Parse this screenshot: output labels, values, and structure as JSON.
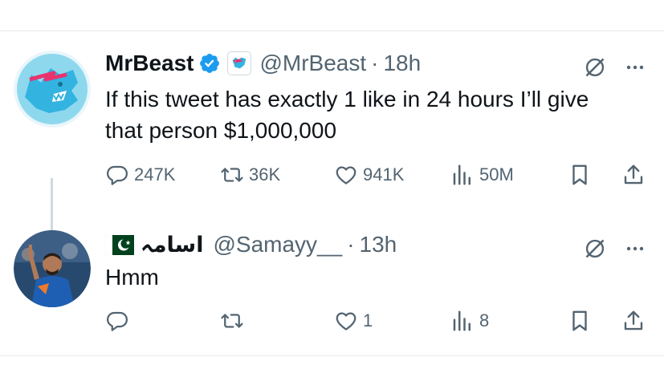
{
  "tweets": [
    {
      "name": "MrBeast",
      "handle": "@MrBeast",
      "time": "18h",
      "separator": "·",
      "text": "If this tweet has exactly 1 like in 24 hours I’ll give that person $1,000,000",
      "stats": {
        "replies": "247K",
        "retweets": "36K",
        "likes": "941K",
        "views": "50M"
      },
      "verified": true,
      "accent_color": "#1d9bf0"
    },
    {
      "name": "اسامہ",
      "handle": "@Samayy__",
      "time": "13h",
      "separator": "·",
      "text": "Hmm",
      "stats": {
        "replies": "",
        "retweets": "",
        "likes": "1",
        "views": "8"
      },
      "flag_icon": "pakistan-flag-icon"
    }
  ],
  "colors": {
    "text": "#0f1419",
    "secondary": "#536471",
    "divider": "#e7e9ea",
    "verified": "#1d9bf0"
  }
}
